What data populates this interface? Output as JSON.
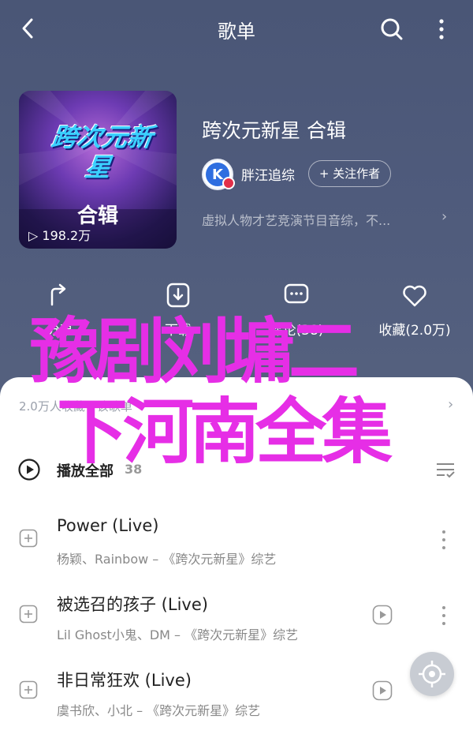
{
  "topbar": {
    "title": "歌单"
  },
  "cover": {
    "logo_text": "跨次元新星",
    "sub_label": "合辑",
    "play_count": "198.2万"
  },
  "playlist": {
    "title": "跨次元新星 合辑",
    "creator_name": "胖汪追综",
    "follow_label": "+ 关注作者",
    "description": "虚拟人物才艺竞演节目音综，不...",
    "desc_arrow": "›"
  },
  "actions": [
    {
      "label": "分享",
      "icon": "share-icon"
    },
    {
      "label": "下载",
      "icon": "download-icon"
    },
    {
      "label": "评论(38)",
      "icon": "comment-icon"
    },
    {
      "label": "收藏(2.0万)",
      "icon": "heart-icon"
    }
  ],
  "overlay": {
    "line1": "豫剧刘墉二",
    "line2": "下河南全集",
    "color": "#e62ee6"
  },
  "collectors": {
    "text": "2.0万人收藏了该歌单",
    "arrow": "›"
  },
  "playall": {
    "label": "播放全部",
    "count": "38"
  },
  "songs": [
    {
      "title": "Power (Live)",
      "meta": "杨颖、Rainbow – 《跨次元新星》综艺",
      "has_mv": false
    },
    {
      "title": "被选召的孩子 (Live)",
      "meta": "Lil Ghost小鬼、DM – 《跨次元新星》综艺",
      "has_mv": true
    },
    {
      "title": "非日常狂欢 (Live)",
      "meta": "虞书欣、小北 – 《跨次元新星》综艺",
      "has_mv": true
    }
  ],
  "colors": {
    "header_bg": "#4f5b7c",
    "accent": "#e62ee6",
    "meta_gray": "#888888"
  }
}
